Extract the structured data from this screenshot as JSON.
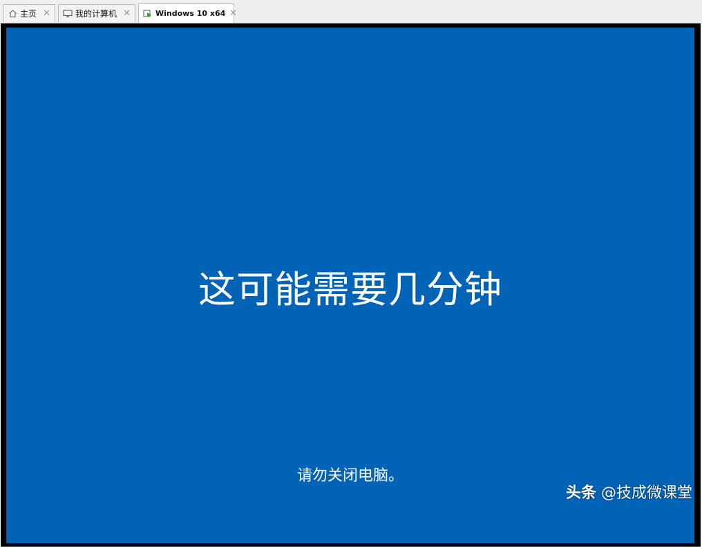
{
  "tabs": [
    {
      "label": "主页",
      "icon": "home-icon",
      "active": false
    },
    {
      "label": "我的计算机",
      "icon": "monitor-icon",
      "active": false
    },
    {
      "label": "Windows 10 x64",
      "icon": "vm-running-icon",
      "active": true
    }
  ],
  "vm": {
    "main_message": "这可能需要几分钟",
    "sub_message": "请勿关闭电脑。",
    "background_color": "#0063b6"
  },
  "watermark": {
    "brand": "头条",
    "handle": "@技成微课堂"
  },
  "colors": {
    "tab_bar": "#f0f0f0",
    "vm_running_accent": "#2aa52a"
  }
}
